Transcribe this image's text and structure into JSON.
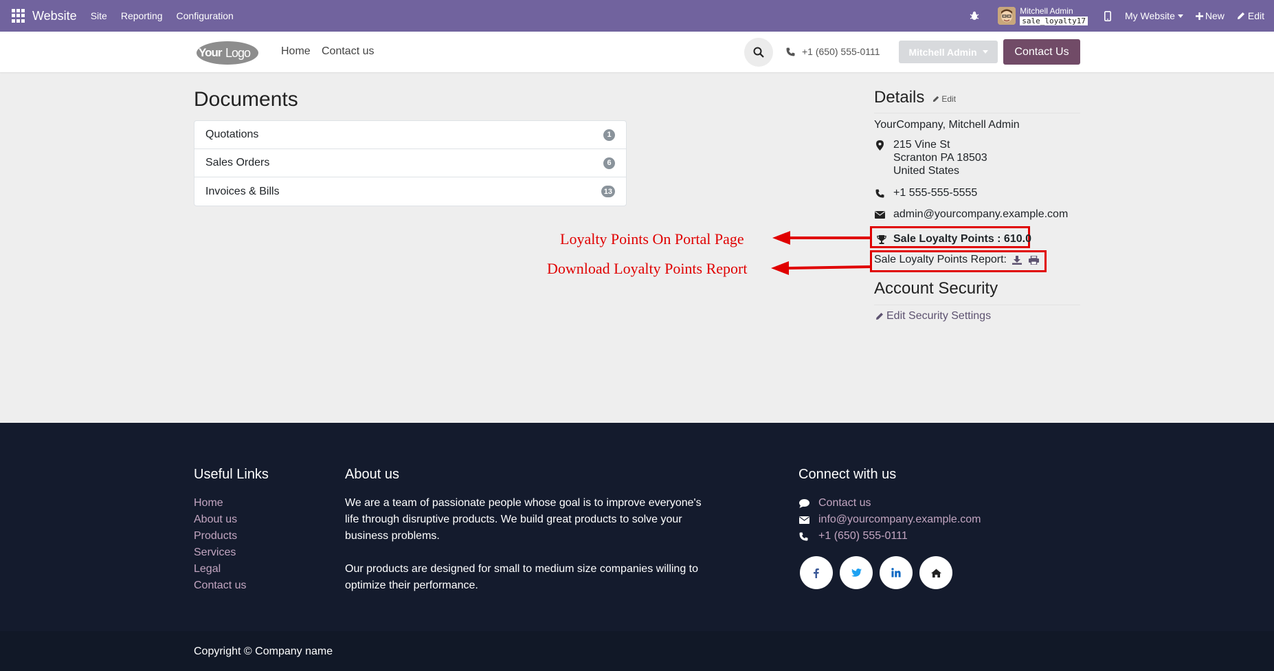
{
  "adminbar": {
    "brand": "Website",
    "menus": [
      "Site",
      "Reporting",
      "Configuration"
    ],
    "user_name": "Mitchell Admin",
    "database": "sale_loyalty17",
    "website_switch": "My Website",
    "new_label": "New",
    "edit_label": "Edit"
  },
  "header": {
    "logo_text_1": "Your",
    "logo_text_2": "Logo",
    "nav": [
      "Home",
      "Contact us"
    ],
    "phone": "+1 (650) 555-0111",
    "user_button": "Mitchell Admin",
    "contact_button": "Contact Us"
  },
  "documents": {
    "title": "Documents",
    "rows": [
      {
        "label": "Quotations",
        "count": "1"
      },
      {
        "label": "Sales Orders",
        "count": "6"
      },
      {
        "label": "Invoices & Bills",
        "count": "13"
      }
    ]
  },
  "details": {
    "title": "Details",
    "edit": "Edit",
    "company": "YourCompany, Mitchell Admin",
    "address_line1": "215 Vine St",
    "address_line2": "Scranton PA 18503",
    "address_line3": "United States",
    "phone": "+1 555-555-5555",
    "email": "admin@yourcompany.example.com",
    "loyalty_points": "Sale Loyalty Points : 610.0",
    "loyalty_report": "Sale Loyalty Points Report:"
  },
  "annotations": {
    "loyalty": "Loyalty Points On Portal Page",
    "report": "Download Loyalty Points Report"
  },
  "security": {
    "title": "Account Security",
    "link": "Edit Security Settings"
  },
  "footer": {
    "useful_links_title": "Useful Links",
    "useful_links": [
      "Home",
      "About us",
      "Products",
      "Services",
      "Legal",
      "Contact us"
    ],
    "about_title": "About us",
    "about_p1": "We are a team of passionate people whose goal is to improve everyone's life through disruptive products. We build great products to solve your business problems.",
    "about_p2": "Our products are designed for small to medium size companies willing to optimize their performance.",
    "connect_title": "Connect with us",
    "connect_contact": "Contact us",
    "connect_email": "info@yourcompany.example.com",
    "connect_phone": "+1 (650) 555-0111",
    "social": [
      "f",
      "t",
      "in",
      "home"
    ],
    "copyright": "Copyright © Company name"
  },
  "colors": {
    "admin_bar": "#71639e",
    "primary": "#714b67",
    "annotation": "#e00000",
    "footer": "#141b2d"
  },
  "icons": [
    "apps-grid-icon",
    "bug-icon",
    "mobile-icon",
    "plus-icon",
    "pencil-icon",
    "search-icon",
    "phone-icon",
    "map-marker-icon",
    "envelope-icon",
    "trophy-icon",
    "download-icon",
    "print-icon",
    "comment-icon",
    "facebook-icon",
    "twitter-icon",
    "linkedin-icon",
    "home-icon"
  ]
}
